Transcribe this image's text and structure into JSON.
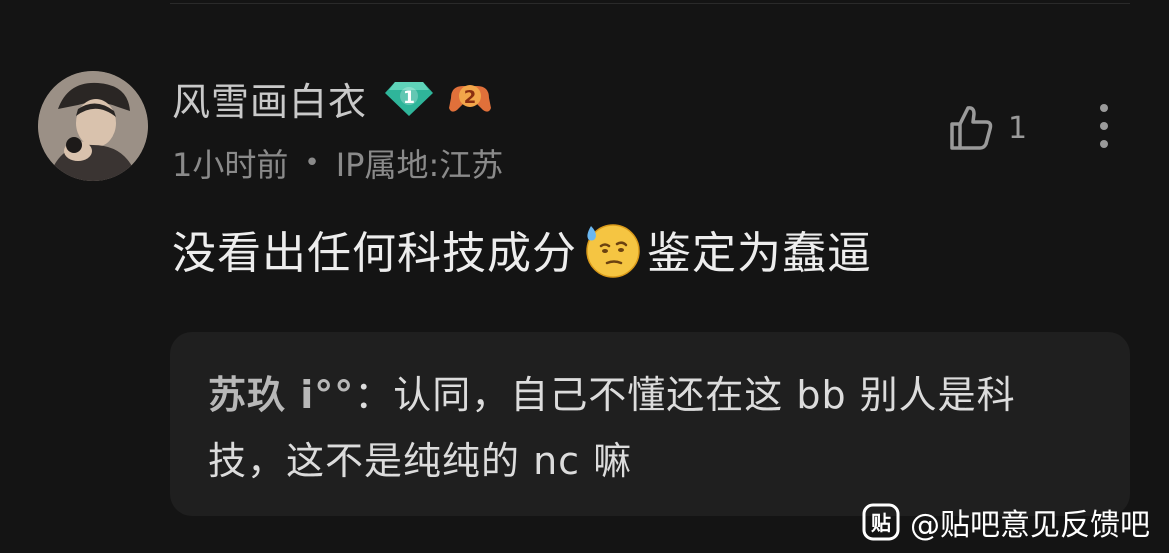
{
  "post": {
    "username": "风雪画白衣",
    "level_badge": "1",
    "game_badge": "2",
    "time": "1小时前",
    "separator": "•",
    "ip_location": "IP属地:江苏",
    "like_count": "1",
    "comment_before_emoji": "没看出任何科技成分",
    "emoji_name": "sweat-face-emoji",
    "comment_after_emoji": "鉴定为蠢逼"
  },
  "reply": {
    "author": "苏玖 i°°",
    "separator": "：",
    "text": "认同，自己不懂还在这 bb 别人是科技，这不是纯纯的 nc 嘛"
  },
  "watermark": {
    "logo_text": "贴",
    "text": "@贴吧意见反馈吧"
  },
  "colors": {
    "background": "#141414",
    "reply_background": "#1f1f1f",
    "level_badge": "#2fb59a",
    "game_badge": "#e0703a"
  },
  "icons": [
    "avatar",
    "level-badge-icon",
    "game-badge-icon",
    "thumbs-up-icon",
    "more-vertical-icon",
    "sweat-face-emoji",
    "tieba-logo-icon"
  ]
}
